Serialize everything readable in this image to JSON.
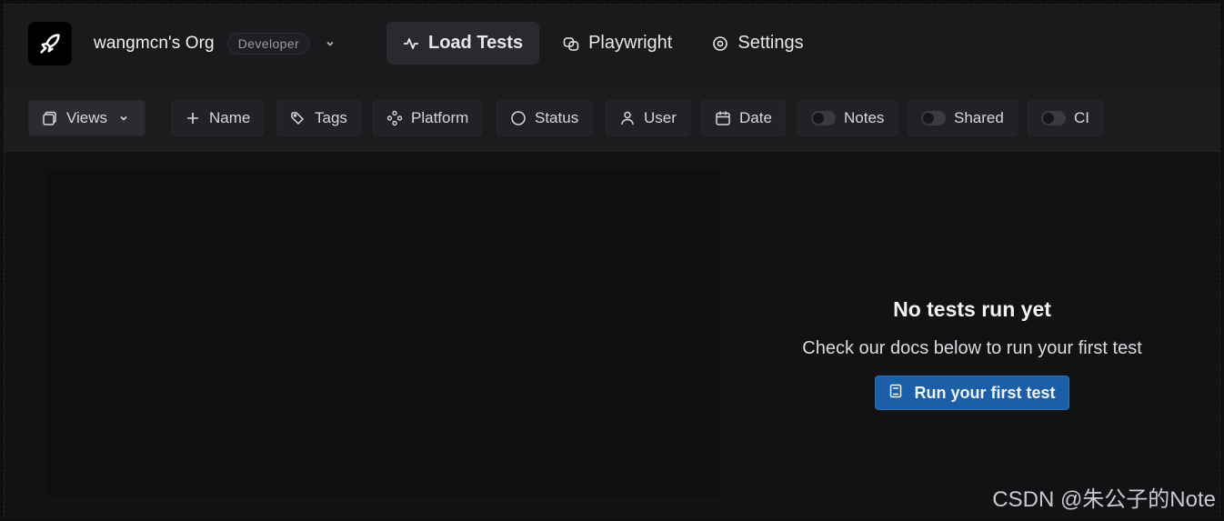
{
  "header": {
    "org_name": "wangmcn's Org",
    "plan_badge": "Developer",
    "tabs": [
      {
        "label": "Load Tests",
        "icon": "activity-icon",
        "active": true
      },
      {
        "label": "Playwright",
        "icon": "masks-icon",
        "active": false
      },
      {
        "label": "Settings",
        "icon": "gear-icon",
        "active": false
      }
    ]
  },
  "filters": {
    "views": "Views",
    "name": "Name",
    "tags": "Tags",
    "platform": "Platform",
    "status": "Status",
    "user": "User",
    "date": "Date",
    "notes": "Notes",
    "shared": "Shared",
    "ci": "CI"
  },
  "empty_state": {
    "title": "No tests run yet",
    "subtitle": "Check our docs below to run your first test",
    "cta": "Run your first test"
  },
  "watermark": "CSDN @朱公子的Note",
  "colors": {
    "accent": "#1a5fa8",
    "background": "#121214"
  }
}
